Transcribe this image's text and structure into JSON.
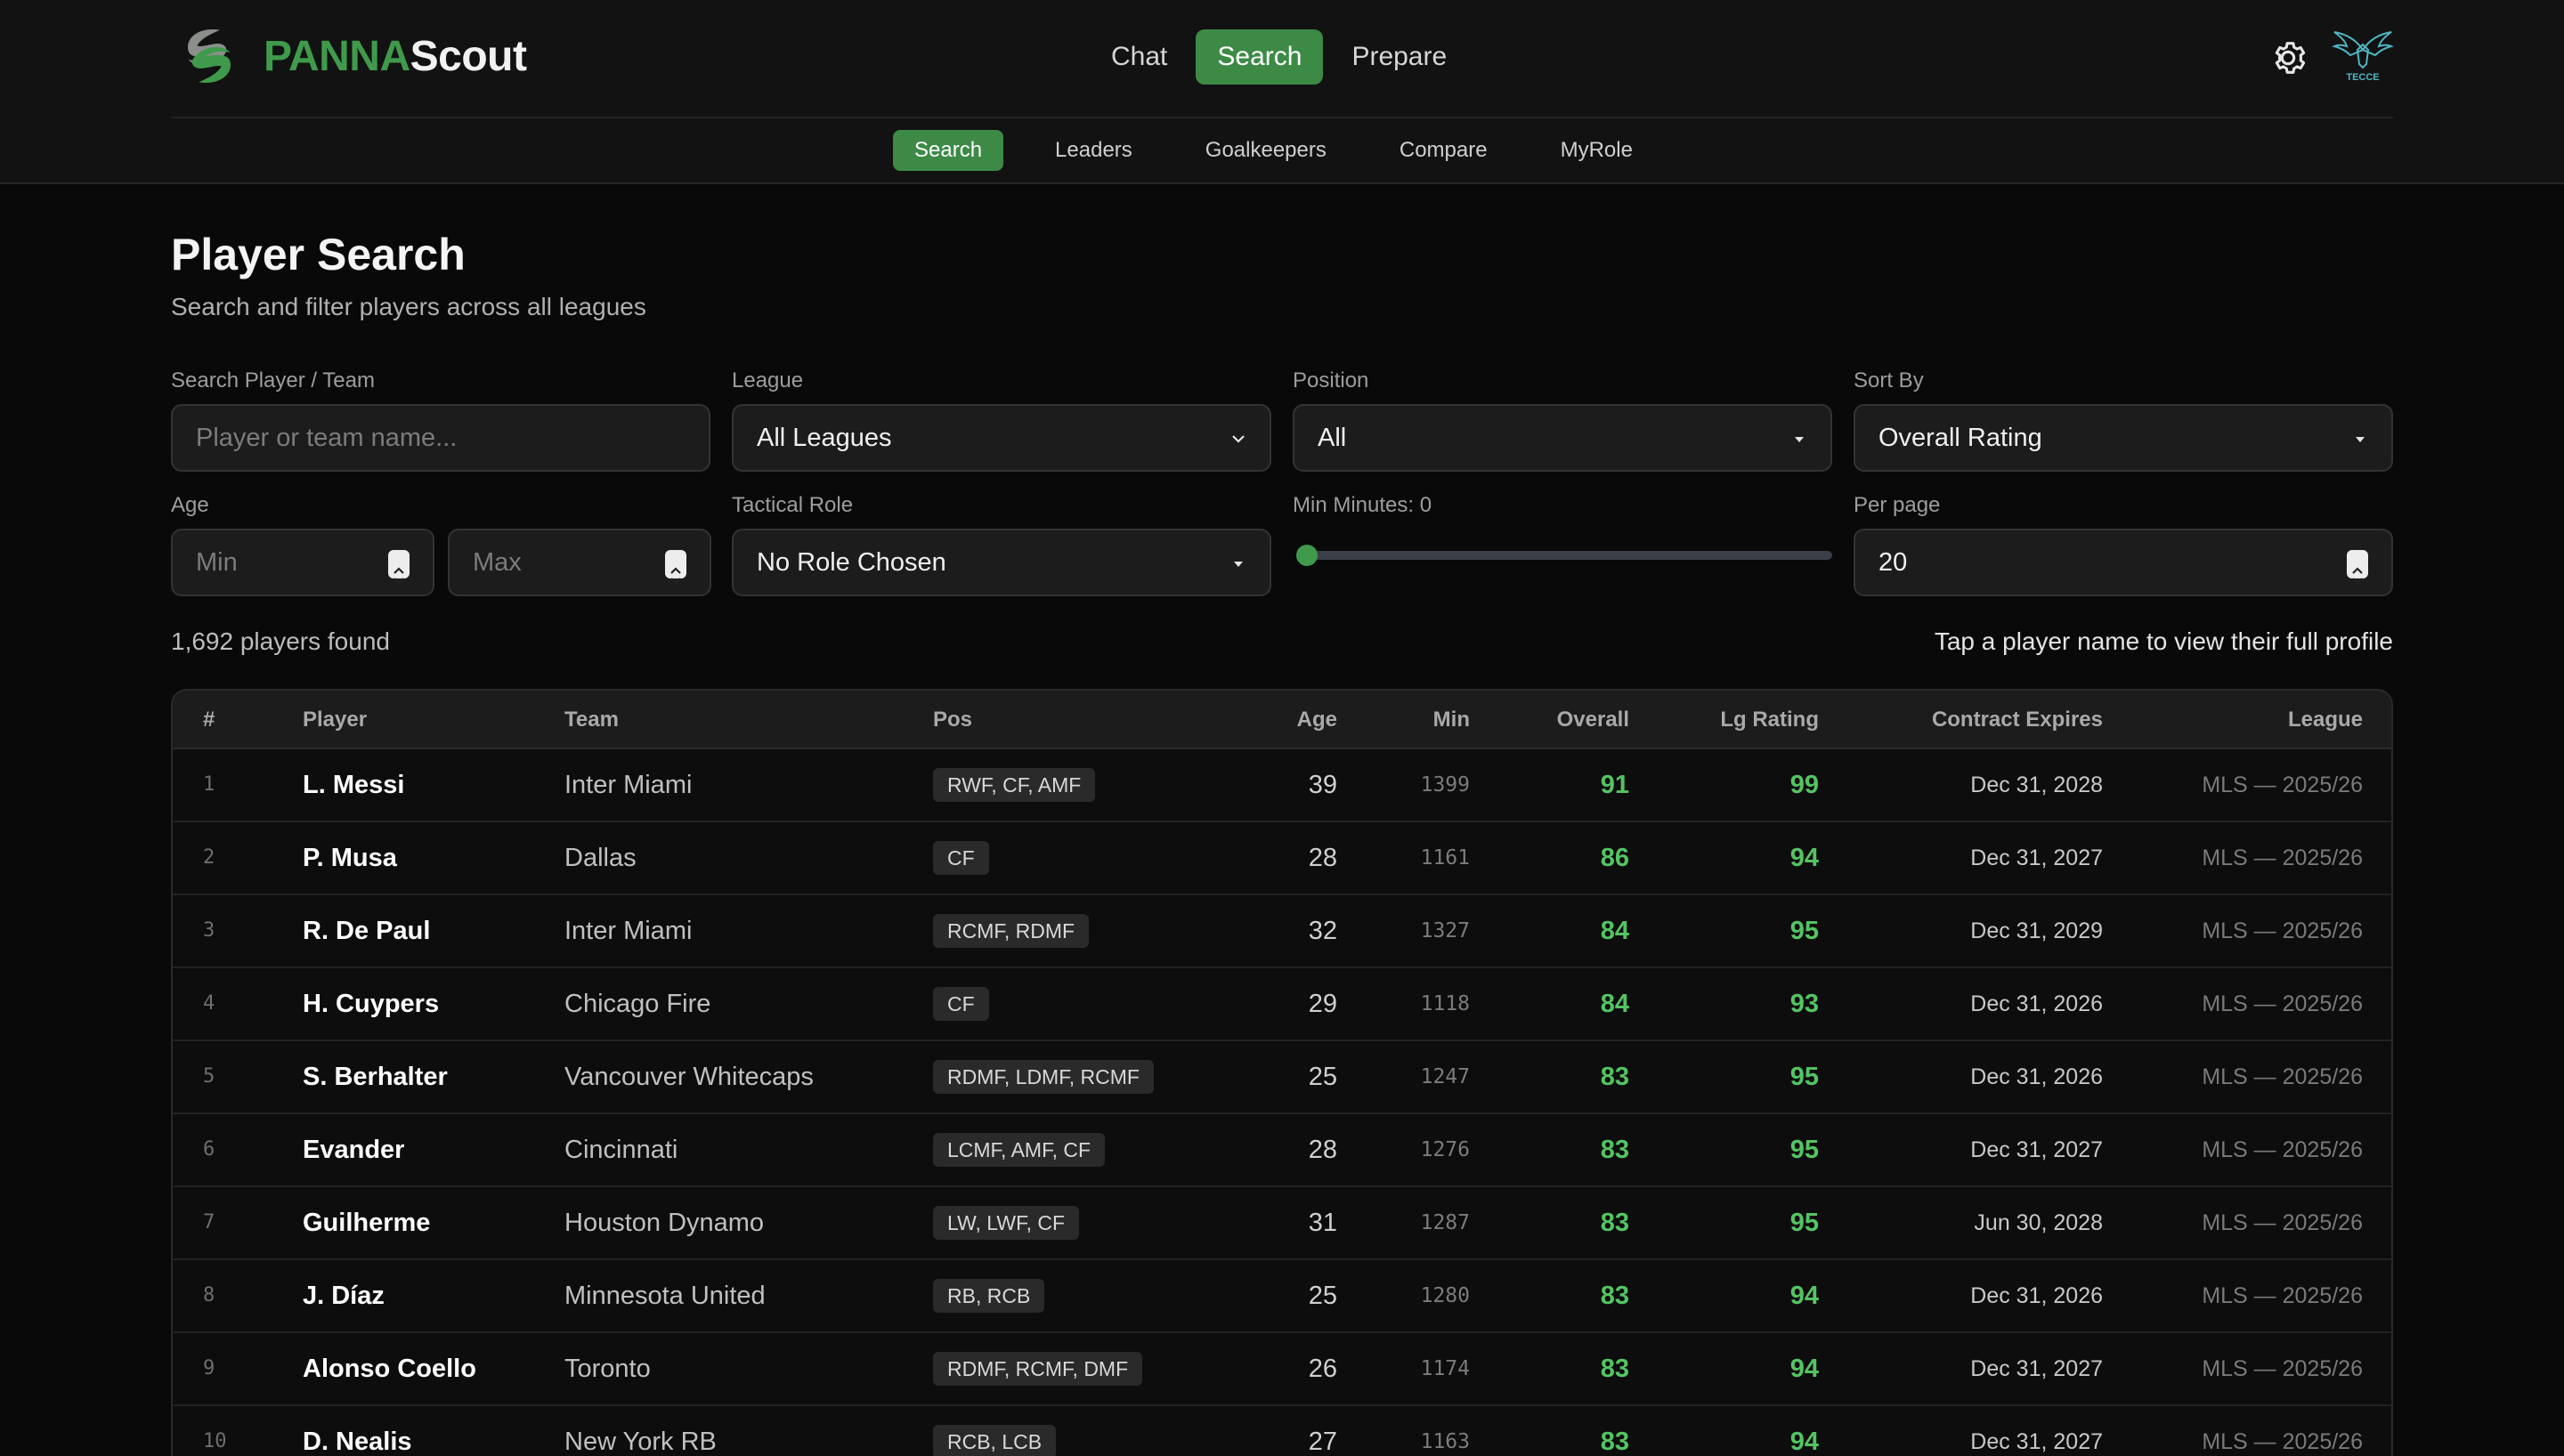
{
  "app": {
    "logo_part1": "PANNA",
    "logo_part2": "Scout",
    "brand_color": "#3f9a4b",
    "team_logo_text": "TECCE"
  },
  "main_nav": [
    {
      "label": "Chat",
      "active": false
    },
    {
      "label": "Search",
      "active": true
    },
    {
      "label": "Prepare",
      "active": false
    }
  ],
  "sub_nav": [
    {
      "label": "Search",
      "active": true
    },
    {
      "label": "Leaders",
      "active": false
    },
    {
      "label": "Goalkeepers",
      "active": false
    },
    {
      "label": "Compare",
      "active": false
    },
    {
      "label": "MyRole",
      "active": false
    }
  ],
  "page": {
    "title": "Player Search",
    "subtitle": "Search and filter players across all leagues"
  },
  "filters": {
    "search_label": "Search Player / Team",
    "search_placeholder": "Player or team name...",
    "league_label": "League",
    "league_value": "All Leagues",
    "position_label": "Position",
    "position_value": "All",
    "sort_label": "Sort By",
    "sort_value": "Overall Rating",
    "age_label": "Age",
    "age_min_placeholder": "Min",
    "age_max_placeholder": "Max",
    "role_label": "Tactical Role",
    "role_value": "No Role Chosen",
    "minutes_label": "Min Minutes: 0",
    "minutes_value": 0,
    "perpage_label": "Per page",
    "perpage_value": "20"
  },
  "results": {
    "count_text": "1,692 players found",
    "hint": "Tap a player name to view their full profile"
  },
  "table": {
    "headers": {
      "num": "#",
      "player": "Player",
      "team": "Team",
      "pos": "Pos",
      "age": "Age",
      "min": "Min",
      "overall": "Overall",
      "lg": "Lg Rating",
      "contract": "Contract Expires",
      "league": "League"
    },
    "rows": [
      {
        "num": "1",
        "player": "L. Messi",
        "team": "Inter Miami",
        "pos": "RWF, CF, AMF",
        "age": "39",
        "min": "1399",
        "overall": "91",
        "lg": "99",
        "contract": "Dec 31, 2028",
        "league": "MLS — 2025/26"
      },
      {
        "num": "2",
        "player": "P. Musa",
        "team": "Dallas",
        "pos": "CF",
        "age": "28",
        "min": "1161",
        "overall": "86",
        "lg": "94",
        "contract": "Dec 31, 2027",
        "league": "MLS — 2025/26"
      },
      {
        "num": "3",
        "player": "R. De Paul",
        "team": "Inter Miami",
        "pos": "RCMF, RDMF",
        "age": "32",
        "min": "1327",
        "overall": "84",
        "lg": "95",
        "contract": "Dec 31, 2029",
        "league": "MLS — 2025/26"
      },
      {
        "num": "4",
        "player": "H. Cuypers",
        "team": "Chicago Fire",
        "pos": "CF",
        "age": "29",
        "min": "1118",
        "overall": "84",
        "lg": "93",
        "contract": "Dec 31, 2026",
        "league": "MLS — 2025/26"
      },
      {
        "num": "5",
        "player": "S. Berhalter",
        "team": "Vancouver Whitecaps",
        "pos": "RDMF, LDMF, RCMF",
        "age": "25",
        "min": "1247",
        "overall": "83",
        "lg": "95",
        "contract": "Dec 31, 2026",
        "league": "MLS — 2025/26"
      },
      {
        "num": "6",
        "player": "Evander",
        "team": "Cincinnati",
        "pos": "LCMF, AMF, CF",
        "age": "28",
        "min": "1276",
        "overall": "83",
        "lg": "95",
        "contract": "Dec 31, 2027",
        "league": "MLS — 2025/26"
      },
      {
        "num": "7",
        "player": "Guilherme",
        "team": "Houston Dynamo",
        "pos": "LW, LWF, CF",
        "age": "31",
        "min": "1287",
        "overall": "83",
        "lg": "95",
        "contract": "Jun 30, 2028",
        "league": "MLS — 2025/26"
      },
      {
        "num": "8",
        "player": "J. Díaz",
        "team": "Minnesota United",
        "pos": "RB, RCB",
        "age": "25",
        "min": "1280",
        "overall": "83",
        "lg": "94",
        "contract": "Dec 31, 2026",
        "league": "MLS — 2025/26"
      },
      {
        "num": "9",
        "player": "Alonso Coello",
        "team": "Toronto",
        "pos": "RDMF, RCMF, DMF",
        "age": "26",
        "min": "1174",
        "overall": "83",
        "lg": "94",
        "contract": "Dec 31, 2027",
        "league": "MLS — 2025/26"
      },
      {
        "num": "10",
        "player": "D. Nealis",
        "team": "New York RB",
        "pos": "RCB, LCB",
        "age": "27",
        "min": "1163",
        "overall": "83",
        "lg": "94",
        "contract": "Dec 31, 2027",
        "league": "MLS — 2025/26"
      }
    ]
  }
}
